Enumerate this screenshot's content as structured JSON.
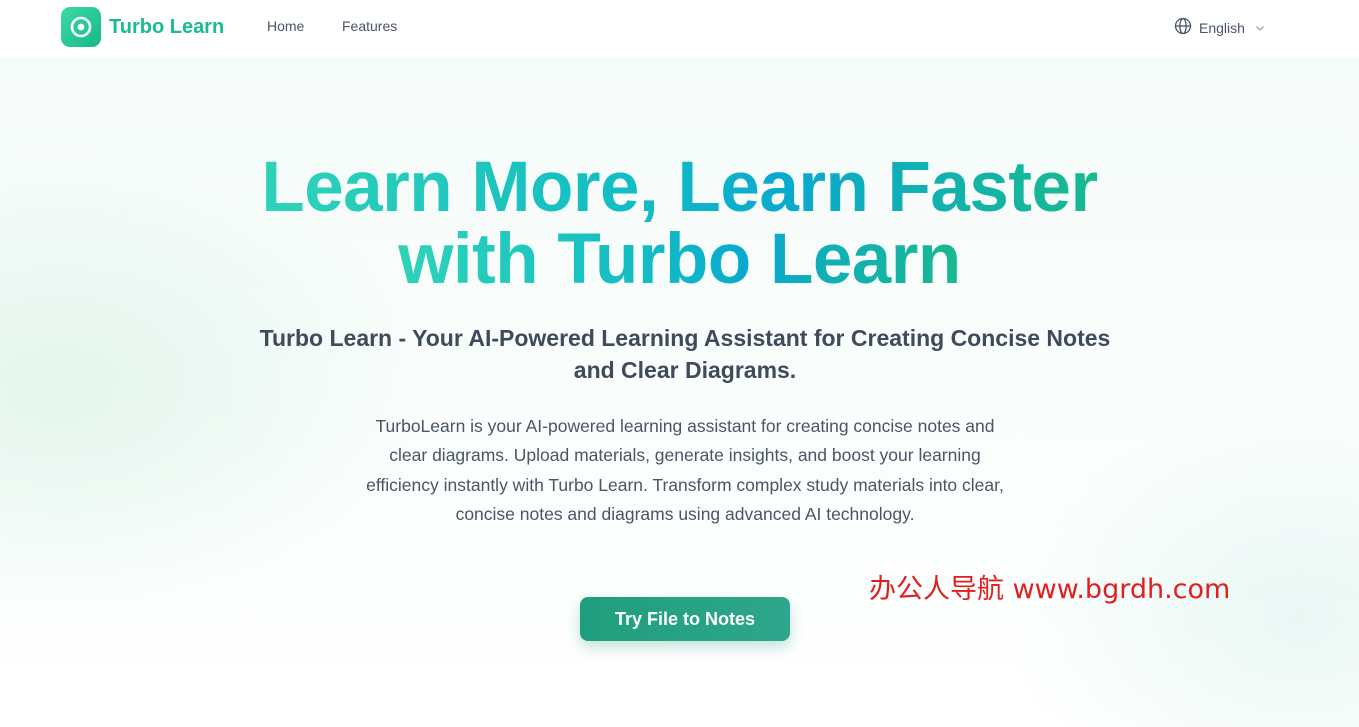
{
  "nav": {
    "brand": "Turbo Learn",
    "links": [
      "Home",
      "Features"
    ],
    "language": "English"
  },
  "hero": {
    "headline_line1": "Learn More, Learn Faster",
    "headline_line2": "with Turbo Learn",
    "subtitle": "Turbo Learn - Your AI-Powered Learning Assistant for Creating Concise Notes and Clear Diagrams.",
    "description": "TurboLearn is your AI-powered learning assistant for creating concise notes and clear diagrams. Upload materials, generate insights, and boost your learning efficiency instantly with Turbo Learn. Transform complex study materials into clear, concise notes and diagrams using advanced AI technology.",
    "cta_label": "Try File to Notes"
  },
  "watermark": "办公人导航 www.bgrdh.com",
  "icons": {
    "logo": "turbo-learn-logo-icon",
    "language": "globe-icon",
    "dropdown": "chevron-down-icon"
  },
  "colors": {
    "brand": "#1cb993",
    "cta": "#1f9e7c",
    "watermark": "#e02020"
  }
}
